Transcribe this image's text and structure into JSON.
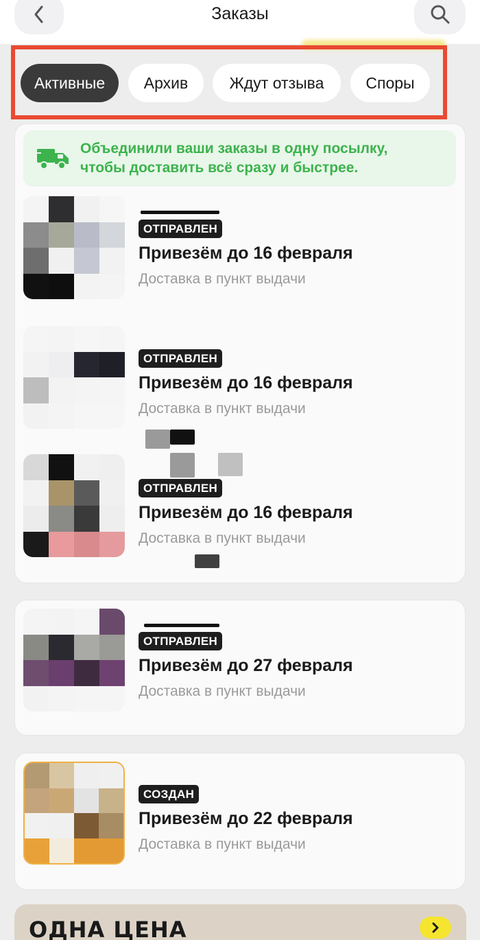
{
  "header": {
    "title": "Заказы",
    "back_icon": "chevron-left-icon",
    "search_icon": "search-icon"
  },
  "tabs": [
    {
      "label": "Активные",
      "active": true
    },
    {
      "label": "Архив",
      "active": false
    },
    {
      "label": "Ждут отзыва",
      "active": false
    },
    {
      "label": "Споры",
      "active": false
    }
  ],
  "banner": {
    "icon": "delivery-truck-icon",
    "text_line1": "Объединили ваши заказы в одну посылку,",
    "text_line2": "чтобы доставить всё сразу и быстрее.",
    "color": "#3cb34d"
  },
  "orders": [
    {
      "status": "ОТПРАВЛЕН",
      "eta": "Привезём до 16 февраля",
      "delivery": "Доставка в пункт выдачи"
    },
    {
      "status": "ОТПРАВЛЕН",
      "eta": "Привезём до 16 февраля",
      "delivery": "Доставка в пункт выдачи"
    },
    {
      "status": "ОТПРАВЛЕН",
      "eta": "Привезём до 16 февраля",
      "delivery": "Доставка в пункт выдачи"
    },
    {
      "status": "ОТПРАВЛЕН",
      "eta": "Привезём до 27 февраля",
      "delivery": "Доставка в пункт выдачи"
    },
    {
      "status": "СОЗДАН",
      "eta": "Привезём до 22 февраля",
      "delivery": "Доставка в пункт выдачи"
    }
  ],
  "promo": {
    "title": "ОДНА ЦЕНА",
    "arrow_icon": "chevron-right-icon"
  },
  "colors": {
    "accent_outline": "#e94a32",
    "badge_bg": "#1e1e1e",
    "promo_button": "#f5e52f"
  }
}
